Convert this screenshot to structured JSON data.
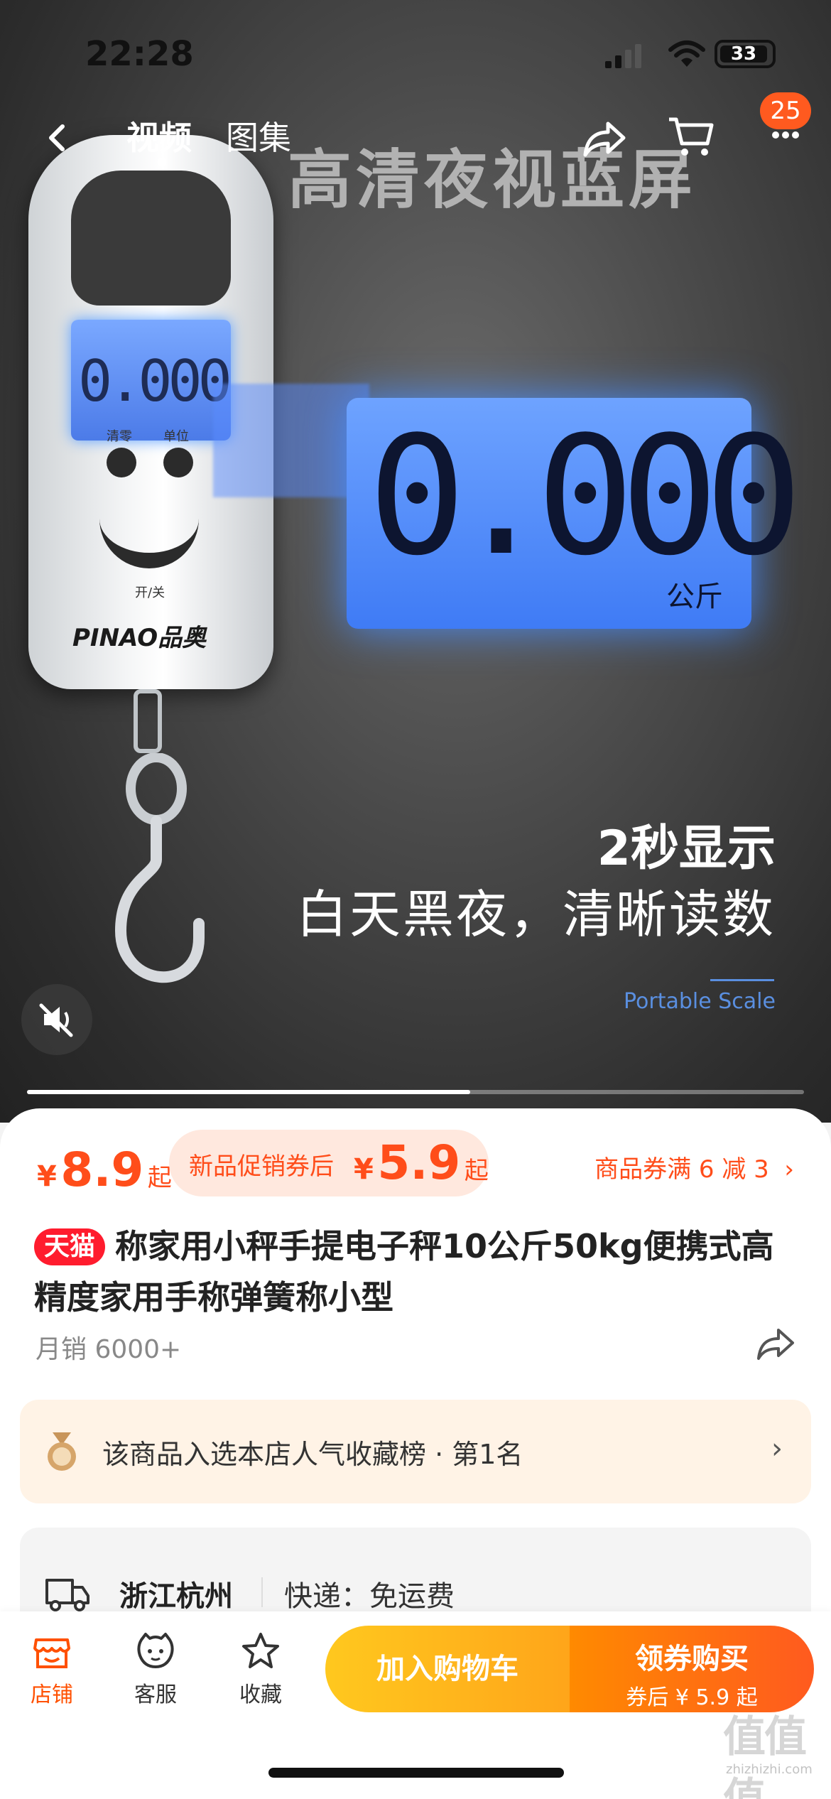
{
  "status_bar": {
    "time": "22:28",
    "battery": "33"
  },
  "top_nav": {
    "tabs": [
      {
        "label": "视频",
        "active": true
      },
      {
        "label": "图集",
        "active": false
      }
    ],
    "cart_badge": "25"
  },
  "hero": {
    "headline": "高清夜视蓝屏",
    "scale_display": "0.000",
    "big_display_value": "0.000",
    "big_display_unit": "公斤",
    "scale_buttons": [
      "清零",
      "单位"
    ],
    "scale_power_label": "开/关",
    "brand": "PINAO品奥",
    "sub_heading": "2秒显示",
    "sub_text": "白天黑夜，清晰读数",
    "portable_label": "Portable Scale",
    "video_progress": 0.57
  },
  "price": {
    "currency": "¥",
    "price": "8.9",
    "suffix": "起",
    "promo_label": "新品促销券后",
    "promo_price": "5.9",
    "coupon_link": "商品券满 6 减 3"
  },
  "product": {
    "badge": "天猫",
    "title": "称家用小秤手提电子秤10公斤50kg便携式高精度家用手称弹簧称小型",
    "sales": "月销 6000+"
  },
  "rank_banner": {
    "text": "该商品入选本店人气收藏榜 · 第1名"
  },
  "shipping": {
    "city": "浙江杭州",
    "info": "快递：免运费"
  },
  "bottom_bar": {
    "nav": [
      {
        "label": "店铺",
        "icon": "store-icon"
      },
      {
        "label": "客服",
        "icon": "customer-service-icon"
      },
      {
        "label": "收藏",
        "icon": "star-icon"
      }
    ],
    "add_to_cart": "加入购物车",
    "buy_label": "领券购买",
    "buy_sub": "券后 ¥ 5.9 起"
  },
  "watermark": {
    "logo": "值值值",
    "url": "zhizhizhi.com"
  },
  "colors": {
    "accent": "#ff4d1a",
    "tmall": "#ff1c2e",
    "cart_btn": "#ffb81c",
    "buy_btn": "#ff6a10"
  }
}
